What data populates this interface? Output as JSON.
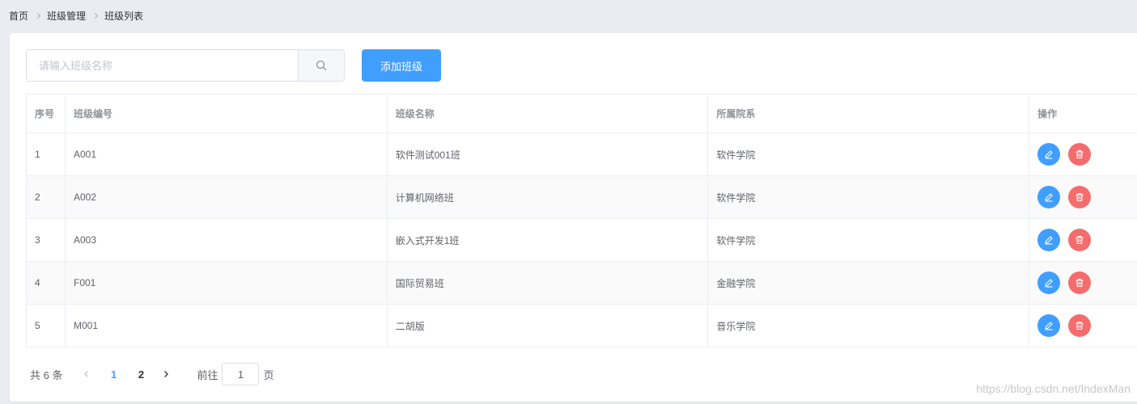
{
  "breadcrumb": [
    "首页",
    "班级管理",
    "班级列表"
  ],
  "search": {
    "placeholder": "请输入班级名称",
    "value": ""
  },
  "toolbar": {
    "add_label": "添加班级"
  },
  "table": {
    "headers": [
      "序号",
      "班级编号",
      "班级名称",
      "所属院系",
      "操作"
    ],
    "rows": [
      [
        "1",
        "A001",
        "软件测试001班",
        "软件学院"
      ],
      [
        "2",
        "A002",
        "计算机网络班",
        "软件学院"
      ],
      [
        "3",
        "A003",
        "嵌入式开发1班",
        "软件学院"
      ],
      [
        "4",
        "F001",
        "国际贸易班",
        "金融学院"
      ],
      [
        "5",
        "M001",
        "二胡版",
        "音乐学院"
      ]
    ]
  },
  "pagination": {
    "total_text": "共 6 条",
    "pages": [
      "1",
      "2"
    ],
    "current": "1",
    "goto_prefix": "前往",
    "goto_value": "1",
    "goto_suffix": "页"
  },
  "watermark": "https://blog.csdn.net/IndexMan",
  "colors": {
    "primary": "#409eff",
    "danger": "#f56c6c",
    "background": "#e9edf2"
  },
  "icons": {
    "search": "search-icon",
    "edit": "edit-icon",
    "delete": "delete-icon",
    "prev": "chevron-left-icon",
    "next": "chevron-right-icon",
    "separator": "chevron-right-icon"
  }
}
